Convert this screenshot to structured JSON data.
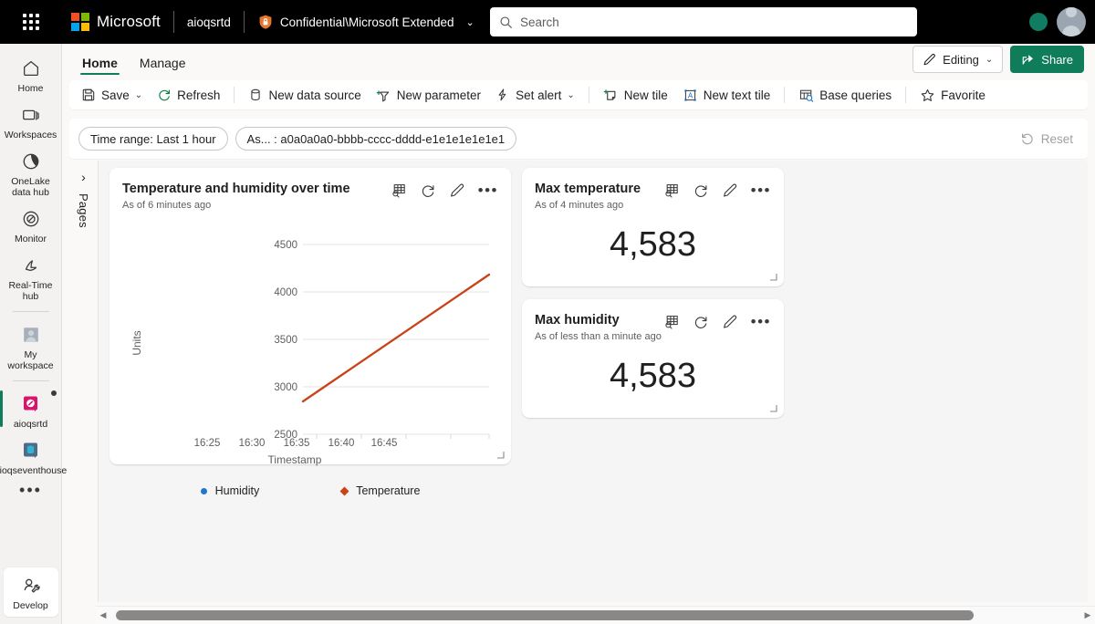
{
  "topbar": {
    "waffle_name": "app-launcher",
    "brand": "Microsoft",
    "workspace": "aioqsrtd",
    "sensitivity_label": "Confidential\\Microsoft Extended",
    "search_placeholder": "Search"
  },
  "sidebar": {
    "items": [
      {
        "label": "Home",
        "icon": "home-icon",
        "selected": false
      },
      {
        "label": "Workspaces",
        "icon": "workspaces-icon",
        "selected": false
      },
      {
        "label": "OneLake data hub",
        "icon": "onelake-icon",
        "selected": false
      },
      {
        "label": "Monitor",
        "icon": "monitor-icon",
        "selected": false
      },
      {
        "label": "Real-Time hub",
        "icon": "realtime-hub-icon",
        "selected": false
      },
      {
        "label": "My workspace",
        "icon": "my-workspace-icon",
        "selected": false
      },
      {
        "label": "aioqsrtd",
        "icon": "realtime-dashboard-icon",
        "selected": true
      },
      {
        "label": "aioqseventhouse",
        "icon": "eventhouse-icon",
        "selected": false
      }
    ],
    "more_label": "•••",
    "develop": {
      "label": "Develop",
      "icon": "develop-icon"
    }
  },
  "ribbon": {
    "tabs": [
      {
        "label": "Home",
        "active": true
      },
      {
        "label": "Manage",
        "active": false
      }
    ],
    "editing_label": "Editing",
    "share_label": "Share"
  },
  "toolbar": {
    "items": [
      {
        "label": "Save",
        "icon": "save-icon",
        "caret": true
      },
      {
        "label": "Refresh",
        "icon": "refresh-icon",
        "caret": false
      },
      {
        "divider_after": true
      },
      {
        "label": "New data source",
        "icon": "database-icon",
        "caret": false
      },
      {
        "label": "New parameter",
        "icon": "new-parameter-icon",
        "caret": false
      },
      {
        "label": "Set alert",
        "icon": "alert-bolt-icon",
        "caret": true
      },
      {
        "divider_after": true
      },
      {
        "label": "New tile",
        "icon": "new-tile-icon",
        "caret": false
      },
      {
        "label": "New text tile",
        "icon": "new-text-tile-icon",
        "caret": false
      },
      {
        "divider_after": true
      },
      {
        "label": "Base queries",
        "icon": "base-queries-icon",
        "caret": false
      },
      {
        "divider_after": true
      },
      {
        "label": "Favorite",
        "icon": "star-icon",
        "caret": false
      }
    ]
  },
  "filterbar": {
    "pills": [
      {
        "label": "Time range: Last 1 hour"
      },
      {
        "label": "As... : a0a0a0a0-bbbb-cccc-dddd-e1e1e1e1e1e1"
      }
    ],
    "reset_label": "Reset",
    "reset_disabled": true
  },
  "canvas": {
    "pages_label": "Pages",
    "pages_chevron": "›"
  },
  "tiles": [
    {
      "id": "temperature-humidity-chart",
      "title": "Temperature and humidity over time",
      "subtitle": "As of 6 minutes ago",
      "actions": [
        "explore-data-icon",
        "refresh-icon",
        "edit-icon",
        "more-options-icon"
      ]
    },
    {
      "id": "max-temperature",
      "title": "Max temperature",
      "subtitle": "As of 4 minutes ago",
      "value": "4,583",
      "actions": [
        "explore-data-icon",
        "refresh-icon",
        "edit-icon",
        "more-options-icon"
      ]
    },
    {
      "id": "max-humidity",
      "title": "Max humidity",
      "subtitle": "As of less than a minute ago",
      "value": "4,583",
      "actions": [
        "explore-data-icon",
        "refresh-icon",
        "edit-icon",
        "more-options-icon"
      ]
    }
  ],
  "chart_data": {
    "type": "line",
    "title": "Temperature and humidity over time",
    "xlabel": "Timestamp",
    "ylabel": "Units",
    "x": [
      "16:25",
      "16:30",
      "16:35",
      "16:40",
      "16:45"
    ],
    "xtick_labels": [
      "16:25",
      "16:30",
      "16:35",
      "16:40",
      "16:45"
    ],
    "ytick_labels": [
      "2500",
      "3000",
      "3500",
      "4000",
      "4500"
    ],
    "ylim": [
      2500,
      4500
    ],
    "grid": true,
    "legend_position": "bottom",
    "series": [
      {
        "name": "Humidity",
        "color": "#1f77d0",
        "marker": "circle",
        "values": []
      },
      {
        "name": "Temperature",
        "color": "#c8431a",
        "marker": "diamond",
        "x": [
          "16:23",
          "16:25",
          "16:30",
          "16:35",
          "16:40",
          "16:45",
          "16:47"
        ],
        "values": [
          2850,
          2985,
          3310,
          3640,
          3960,
          4150,
          4180
        ]
      }
    ]
  },
  "colors": {
    "accent": "#0f7c5a",
    "temperature_line": "#c8431a",
    "humidity": "#1f77d0",
    "topbar_bg": "#000000",
    "canvas_bg": "#f5f5f5"
  },
  "scrollbar": {
    "left_arrow": "◀",
    "right_arrow": "▶"
  }
}
